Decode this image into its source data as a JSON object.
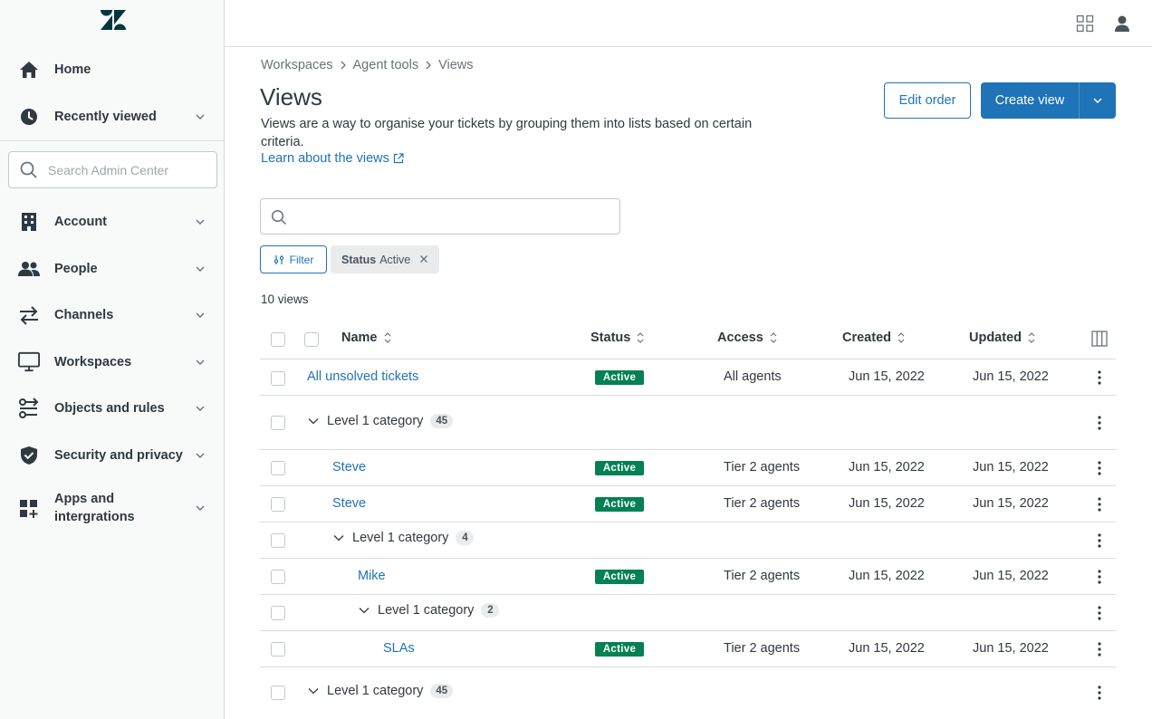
{
  "sidebar": {
    "items": [
      {
        "label": "Home",
        "icon": "home-icon"
      },
      {
        "label": "Recently viewed",
        "icon": "clock-icon"
      },
      {
        "label": "Account",
        "icon": "building-icon"
      },
      {
        "label": "People",
        "icon": "people-icon"
      },
      {
        "label": "Channels",
        "icon": "arrows-icon"
      },
      {
        "label": "Workspaces",
        "icon": "monitor-icon"
      },
      {
        "label": "Objects and rules",
        "icon": "objects-rules-icon"
      },
      {
        "label": "Security and privacy",
        "icon": "shield-icon"
      },
      {
        "label": "Apps and intergrations",
        "icon": "apps-icon"
      }
    ],
    "search_placeholder": "Search Admin Center"
  },
  "breadcrumb": [
    "Workspaces",
    "Agent tools",
    "Views"
  ],
  "page": {
    "title": "Views",
    "description": "Views are a way to organise your tickets by grouping them into lists based on certain criteria.",
    "learn_link": "Learn about the views"
  },
  "actions": {
    "edit_order": "Edit order",
    "create_view": "Create view"
  },
  "filter": {
    "button": "Filter",
    "tag_key": "Status",
    "tag_value": "Active"
  },
  "views_count": "10 views",
  "table": {
    "headers": {
      "name": "Name",
      "status": "Status",
      "access": "Access",
      "created": "Created",
      "updated": "Updated"
    },
    "rows": [
      {
        "type": "view",
        "name": "All unsolved tickets",
        "status": "Active",
        "access": "All agents",
        "created": "Jun 15, 2022",
        "updated": "Jun 15, 2022"
      },
      {
        "type": "category",
        "name": "Level 1 category",
        "count": "45"
      },
      {
        "type": "view",
        "name": "Steve",
        "status": "Active",
        "access": "Tier 2 agents",
        "created": "Jun 15, 2022",
        "updated": "Jun 15, 2022"
      },
      {
        "type": "view",
        "name": "Steve",
        "status": "Active",
        "access": "Tier 2 agents",
        "created": "Jun 15, 2022",
        "updated": "Jun 15, 2022"
      },
      {
        "type": "category",
        "name": "Level 1 category",
        "count": "4"
      },
      {
        "type": "view",
        "name": "Mike",
        "status": "Active",
        "access": "Tier 2 agents",
        "created": "Jun 15, 2022",
        "updated": "Jun 15, 2022"
      },
      {
        "type": "category",
        "name": "Level 1 category",
        "count": "2"
      },
      {
        "type": "view",
        "name": "SLAs",
        "status": "Active",
        "access": "Tier 2 agents",
        "created": "Jun 15, 2022",
        "updated": "Jun 15, 2022"
      },
      {
        "type": "category",
        "name": "Level 1 category",
        "count": "45"
      }
    ]
  },
  "colors": {
    "brand_blue": "#1f73b7",
    "active_green": "#038153",
    "text": "#2f3941"
  }
}
